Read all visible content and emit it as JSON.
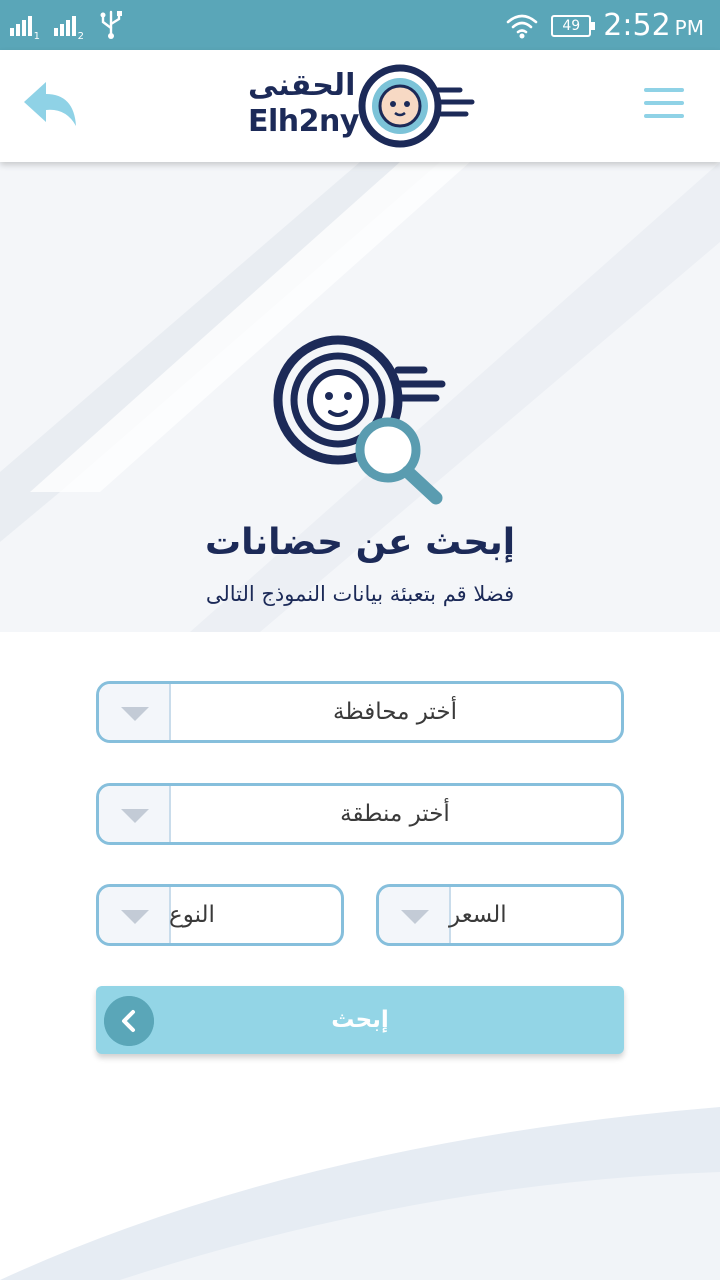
{
  "status_bar": {
    "sim1": "1",
    "sim2": "2",
    "battery": "49",
    "time": "2:52",
    "ampm": "PM"
  },
  "header": {
    "logo_ar": "الحقنى",
    "logo_en": "Elh2ny"
  },
  "hero": {
    "title": "إبحث عن حضانات",
    "subtitle": "فضلا قم بتعبئة بيانات النموذج التالى"
  },
  "form": {
    "governorate": "أختر محافظة",
    "area": "أختر منطقة",
    "type": "النوع",
    "price": "السعر"
  },
  "search_button": {
    "label": "إبحث"
  },
  "colors": {
    "status_bar": "#5aa6b8",
    "accent_light": "#93d5e6",
    "brand_navy": "#1c2a58",
    "field_border": "#86bfdc"
  },
  "icons": [
    "signal-icon",
    "usb-icon",
    "wifi-icon",
    "battery-icon",
    "back-arrow-icon",
    "menu-icon",
    "logo-icon",
    "search-nursery-icon",
    "dropdown-arrow-icon",
    "chevron-left-icon"
  ]
}
